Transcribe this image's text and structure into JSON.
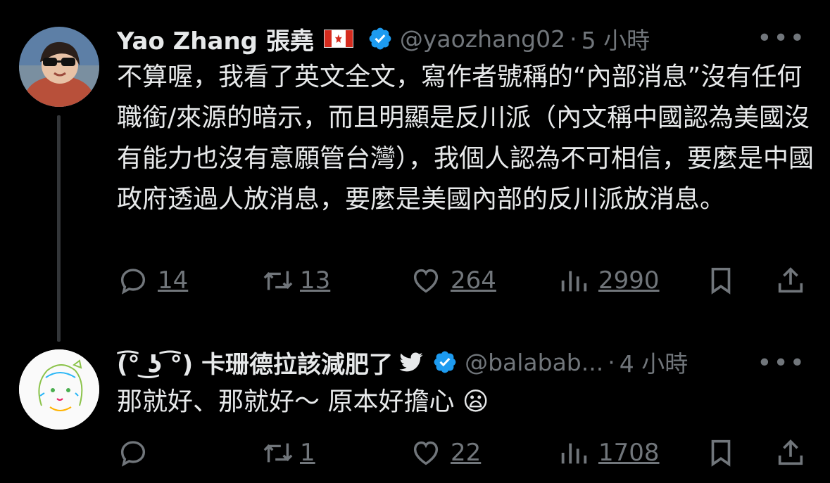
{
  "tweets": [
    {
      "name": "Yao Zhang 張堯",
      "handle": "@yaozhang02",
      "dot": "·",
      "time": "5 小時",
      "more": "•••",
      "text": "不算喔，我看了英文全文，寫作者號稱的“內部消息”沒有任何職銜/來源的暗示，而且明顯是反川派（內文稱中國認為美國沒有能力也沒有意願管台灣），我個人認為不可相信，要麼是中國政府透過人放消息，要麼是美國內部的反川派放消息。",
      "reply_count": "14",
      "retweet_count": "13",
      "like_count": "264",
      "view_count": "2990",
      "flag_icon": "canada-flag-icon"
    },
    {
      "name": "(͡° ͜ʖ ͡°) 卡珊德拉該減肥了",
      "handle": "@balabab...",
      "dot": "·",
      "time": "4 小時",
      "more": "•••",
      "text": "那就好、那就好～ 原本好擔心",
      "emoji": "😦",
      "reply_count": "",
      "retweet_count": "1",
      "like_count": "22",
      "view_count": "1708"
    }
  ],
  "colors": {
    "background": "#000000",
    "text": "#e7e9ea",
    "muted": "#71767b",
    "verified": "#1d9bf0"
  }
}
